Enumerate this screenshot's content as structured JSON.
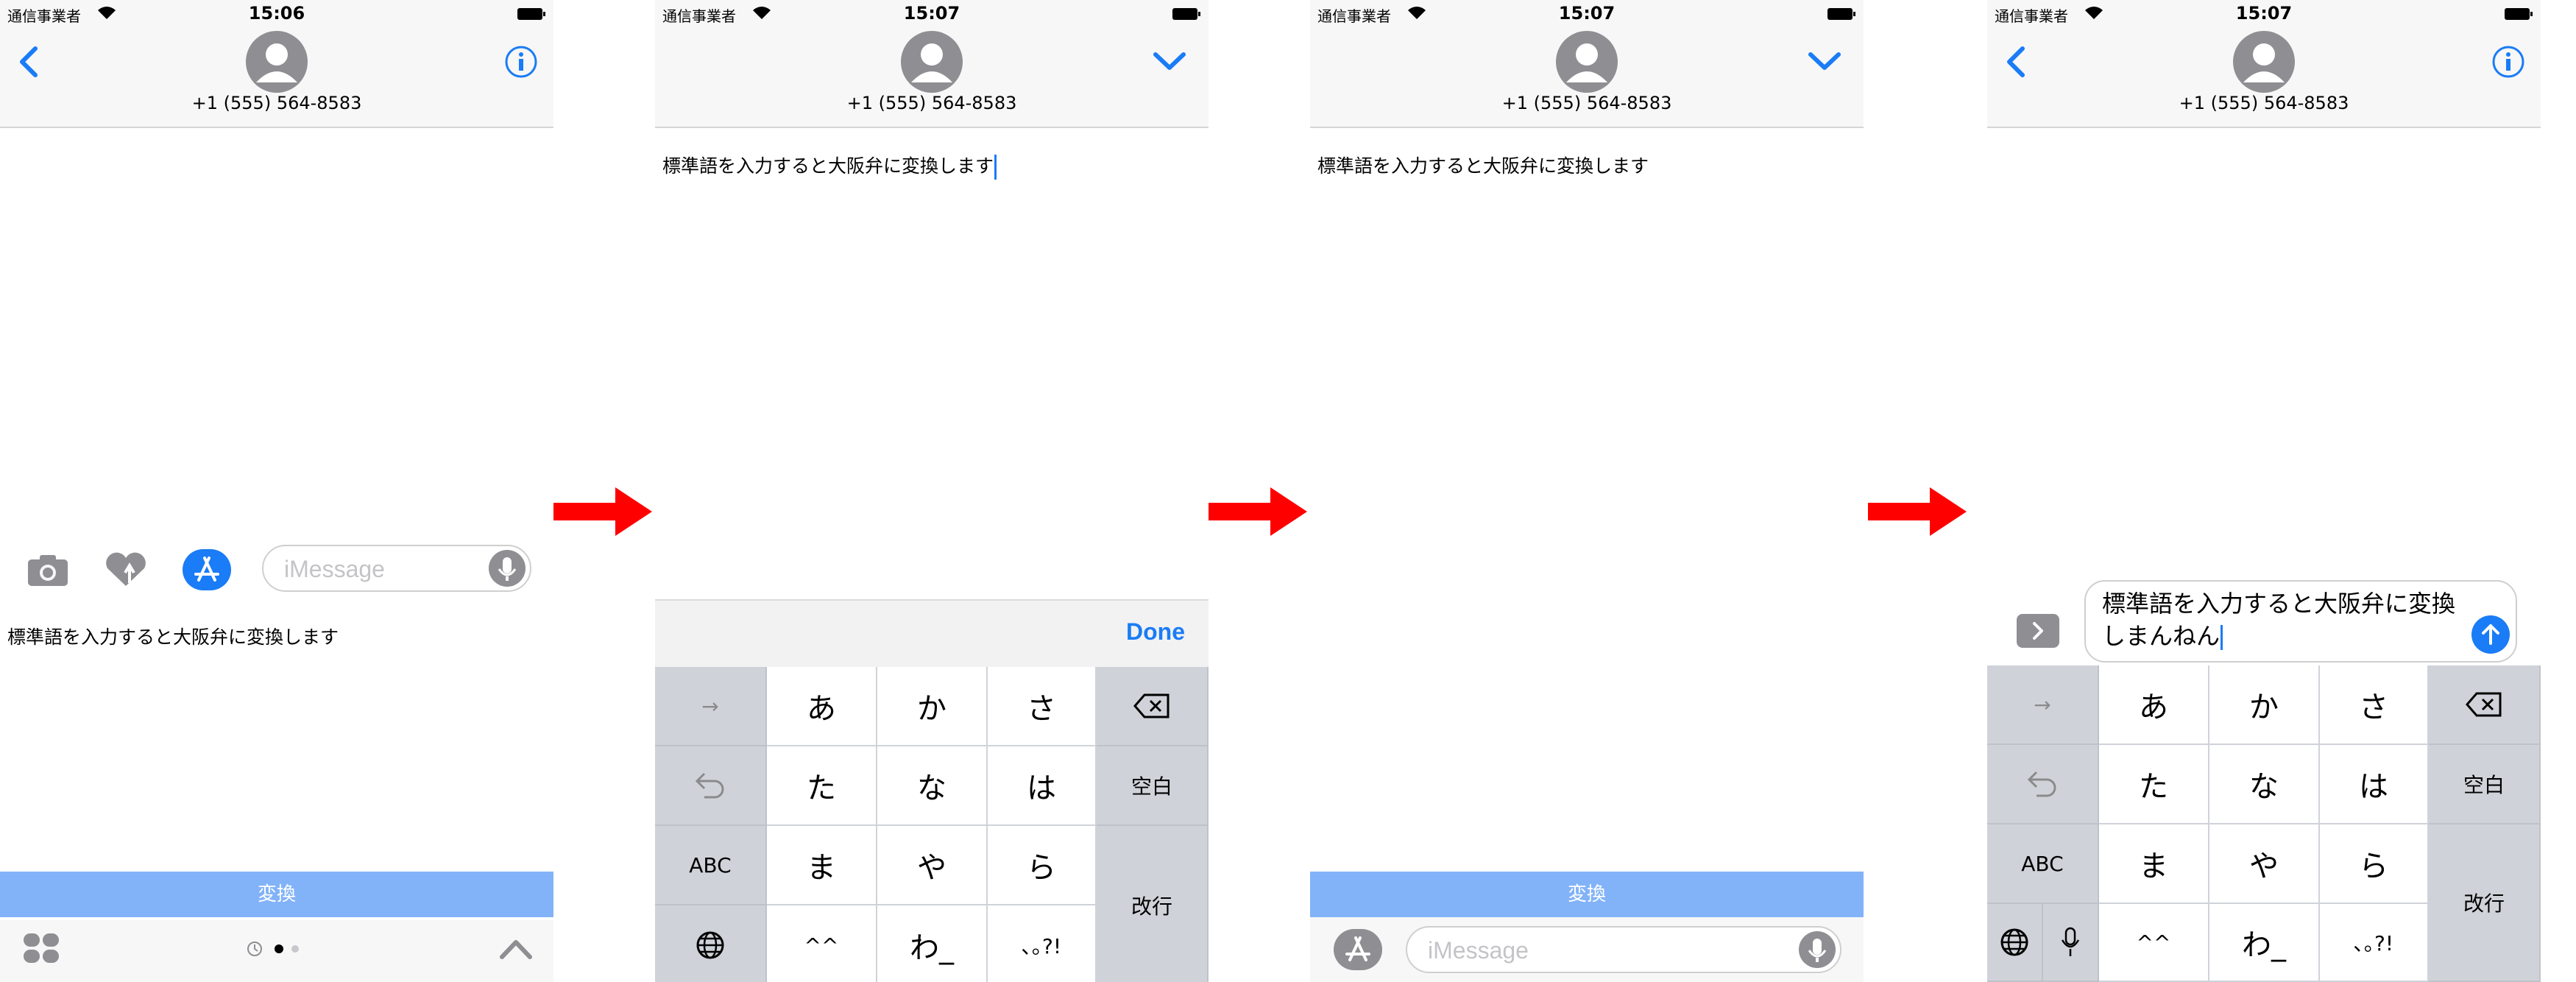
{
  "status": {
    "carrier": "通信事業者",
    "time_1": "15:06",
    "time_2": "15:07",
    "time_3": "15:07",
    "time_4": "15:07"
  },
  "contact": "+1 (555) 564-8583",
  "message_text": "標準語を入力すると大阪弁に変換します",
  "converted_line1": "標準語を入力すると大阪弁に変換",
  "converted_line2": "しまんねん",
  "imessage_placeholder": "iMessage",
  "convert_label": "変換",
  "done_label": "Done",
  "keyboard": {
    "row1": [
      "→",
      "あ",
      "か",
      "さ"
    ],
    "row2": [
      "た",
      "な",
      "は"
    ],
    "row3": [
      "ABC",
      "ま",
      "や",
      "ら"
    ],
    "row4": [
      "^^",
      "わ_",
      "､｡?!"
    ],
    "space": "空白",
    "enter": "改行"
  },
  "colors": {
    "accent": "#1a7cf6",
    "convert_bar": "#82b3f8",
    "arrow": "#ff0000"
  },
  "icons": [
    "back-chevron-icon",
    "info-icon",
    "down-chevron-icon",
    "camera-icon",
    "digital-touch-icon",
    "app-store-icon",
    "mic-icon",
    "apps-grid-icon",
    "up-chevron-icon",
    "send-icon",
    "delete-key-icon",
    "undo-icon",
    "globe-icon"
  ]
}
